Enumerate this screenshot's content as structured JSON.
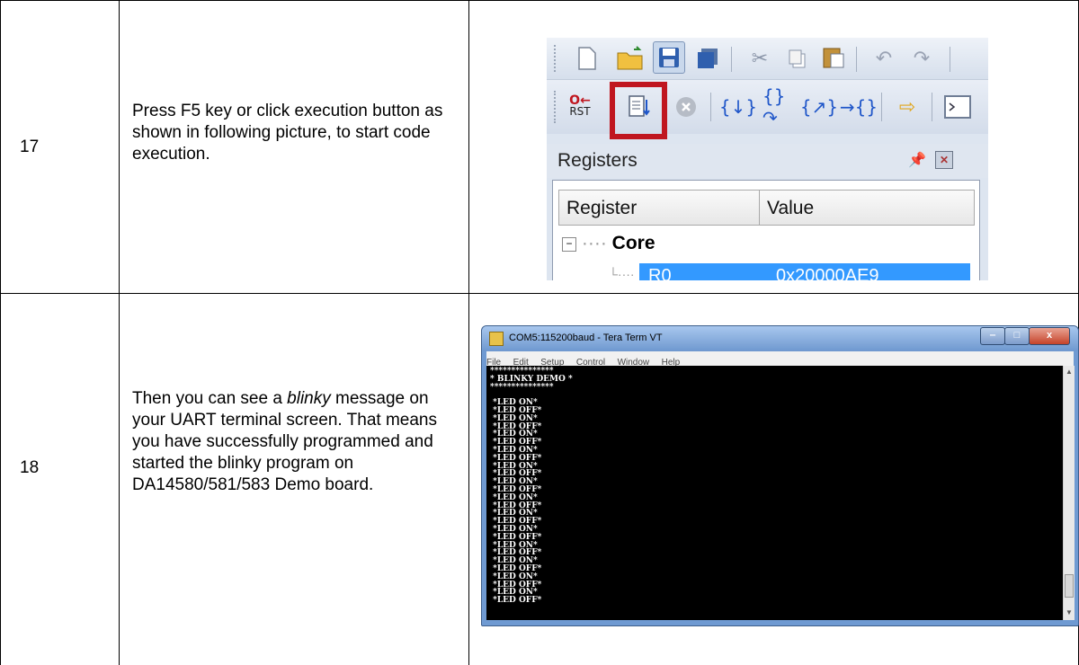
{
  "rows": [
    {
      "step": "17",
      "description_parts": [
        "Press F5 key or click execution button as shown in following picture, to start code execution."
      ]
    },
    {
      "step": "18",
      "description_before": "Then you can see a ",
      "description_italic": "blinky",
      "description_after": " message on your UART terminal screen. That means you have successfully programmed and started the blinky program on DA14580/581/583 Demo board."
    }
  ],
  "ide": {
    "rst_label": "RST",
    "pane_title": "Registers",
    "pin_icon": "pin-icon",
    "close_icon": "close-icon",
    "columns": [
      "Register",
      "Value"
    ],
    "tree_group": "Core",
    "tree_row_name": "R0",
    "tree_row_value": "0x20000AE9",
    "highlight_color": "#c0161f",
    "selection_color": "#3399ff"
  },
  "teraterm": {
    "title": "COM5:115200baud - Tera Term VT",
    "menu": [
      "File",
      "Edit",
      "Setup",
      "Control",
      "Window",
      "Help"
    ],
    "lines": [
      "***************",
      "* BLINKY DEMO *",
      "***************",
      "",
      " *LED ON*",
      " *LED OFF*",
      " *LED ON*",
      " *LED OFF*",
      " *LED ON*",
      " *LED OFF*",
      " *LED ON*",
      " *LED OFF*",
      " *LED ON*",
      " *LED OFF*",
      " *LED ON*",
      " *LED OFF*",
      " *LED ON*",
      " *LED OFF*",
      " *LED ON*",
      " *LED OFF*",
      " *LED ON*",
      " *LED OFF*",
      " *LED ON*",
      " *LED OFF*",
      " *LED ON*",
      " *LED OFF*",
      " *LED ON*",
      " *LED OFF*",
      " *LED ON*",
      " *LED OFF*"
    ]
  }
}
